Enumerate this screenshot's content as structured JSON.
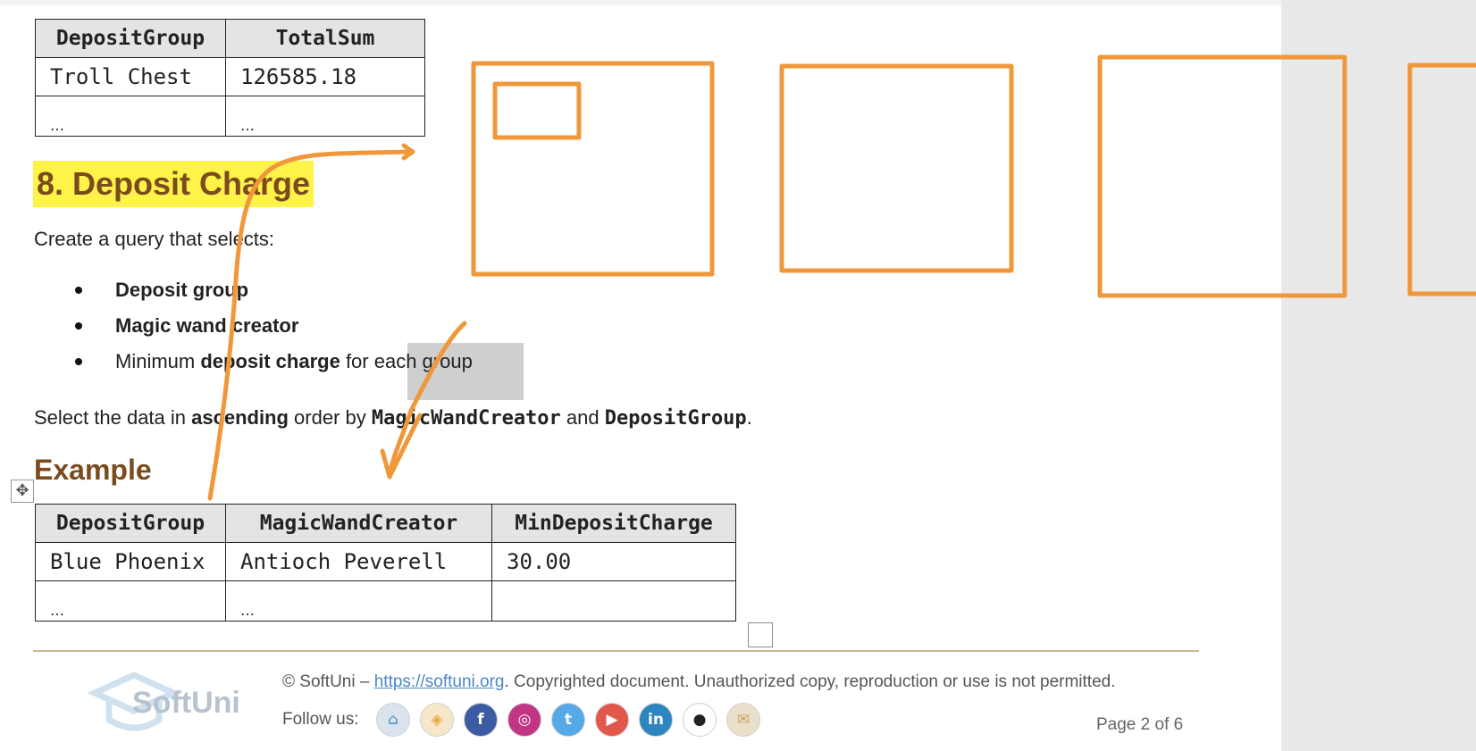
{
  "top_table": {
    "headers": [
      "DepositGroup",
      "TotalSum"
    ],
    "rows": [
      [
        "Troll Chest",
        "126585.18"
      ],
      [
        "…",
        "…"
      ]
    ]
  },
  "section": {
    "heading": "8. Deposit Charge",
    "intro": "Create a query that selects:",
    "bullets": [
      {
        "bold": "Deposit group",
        "rest": ""
      },
      {
        "bold": "Magic wand creator",
        "rest": ""
      },
      {
        "pre": "Minimum ",
        "bold": "deposit charge",
        "rest": " for each group"
      }
    ],
    "order_text": {
      "p1": "Select the data in ",
      "b1": "ascending",
      "p2": " order by ",
      "c1": "MagicWandCreator",
      "p3": " and ",
      "c2": "DepositGroup",
      "p4": "."
    }
  },
  "example": {
    "heading": "Example",
    "headers": [
      "DepositGroup",
      "MagicWandCreator",
      "MinDepositCharge"
    ],
    "rows": [
      [
        "Blue Phoenix",
        "Antioch Peverell",
        "30.00"
      ],
      [
        "…",
        "…",
        ""
      ]
    ]
  },
  "footer": {
    "logo_text": "SoftUni",
    "copyright_prefix": "© SoftUni – ",
    "copyright_link": "https://softuni.org",
    "copyright_suffix": ". Copyrighted document. Unauthorized copy, reproduction or use is not permitted.",
    "follow_label": "Follow us:",
    "page_label": "Page 2 of 6",
    "social_icons": [
      {
        "name": "softuni-icon",
        "glyph": "⌂",
        "color": "#d9e4ee",
        "fg": "#6fa1cf"
      },
      {
        "name": "softuni-foundation-icon",
        "glyph": "◈",
        "color": "#f6e7c9",
        "fg": "#e8a73c"
      },
      {
        "name": "facebook-icon",
        "glyph": "f",
        "color": "#3b5ba5",
        "fg": "#ffffff"
      },
      {
        "name": "instagram-icon",
        "glyph": "◎",
        "color": "#c13584",
        "fg": "#ffffff"
      },
      {
        "name": "twitter-icon",
        "glyph": "t",
        "color": "#55a9e6",
        "fg": "#ffffff"
      },
      {
        "name": "youtube-icon",
        "glyph": "▶",
        "color": "#e2574c",
        "fg": "#ffffff"
      },
      {
        "name": "linkedin-icon",
        "glyph": "in",
        "color": "#2e86c1",
        "fg": "#ffffff"
      },
      {
        "name": "github-icon",
        "glyph": "●",
        "color": "#ffffff",
        "fg": "#222222"
      },
      {
        "name": "email-icon",
        "glyph": "✉",
        "color": "#eadfc9",
        "fg": "#c9a467"
      }
    ]
  },
  "colors": {
    "annotation": "#f0973a",
    "heading": "#7b4b1e",
    "highlight": "#fff34a"
  }
}
